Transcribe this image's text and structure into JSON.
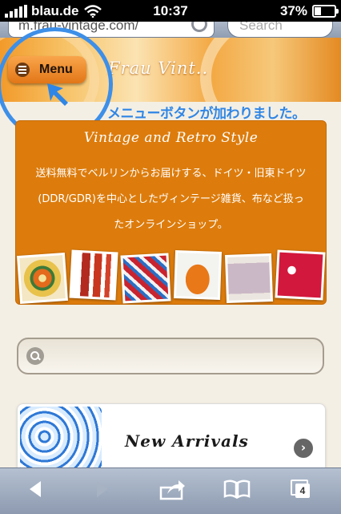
{
  "status_bar": {
    "carrier": "blau.de",
    "time": "10:37",
    "battery": "37%",
    "battery_level": 0.37
  },
  "address_bar": {
    "url": "m.frau-vintage.com/",
    "search_placeholder": "Search"
  },
  "header": {
    "site_name": "Frau Vint..",
    "menu_label": "Menu"
  },
  "annotation": {
    "text": "メニューボタンが加わりました。"
  },
  "intro": {
    "title": "Vintage and Retro Style",
    "lines": [
      "送料無料でベルリンからお届けする、ドイツ・旧東ドイツ",
      "(DDR/GDR)を中心としたヴィンテージ雑貨、布など扱っ",
      "たオンラインショップ。"
    ]
  },
  "new_arrivals": {
    "title": "New Arrivals"
  },
  "toolbar": {
    "tab_count": "4"
  },
  "colors": {
    "accent_orange": "#dd7c0c",
    "annotation_blue": "#3d8fe8"
  }
}
